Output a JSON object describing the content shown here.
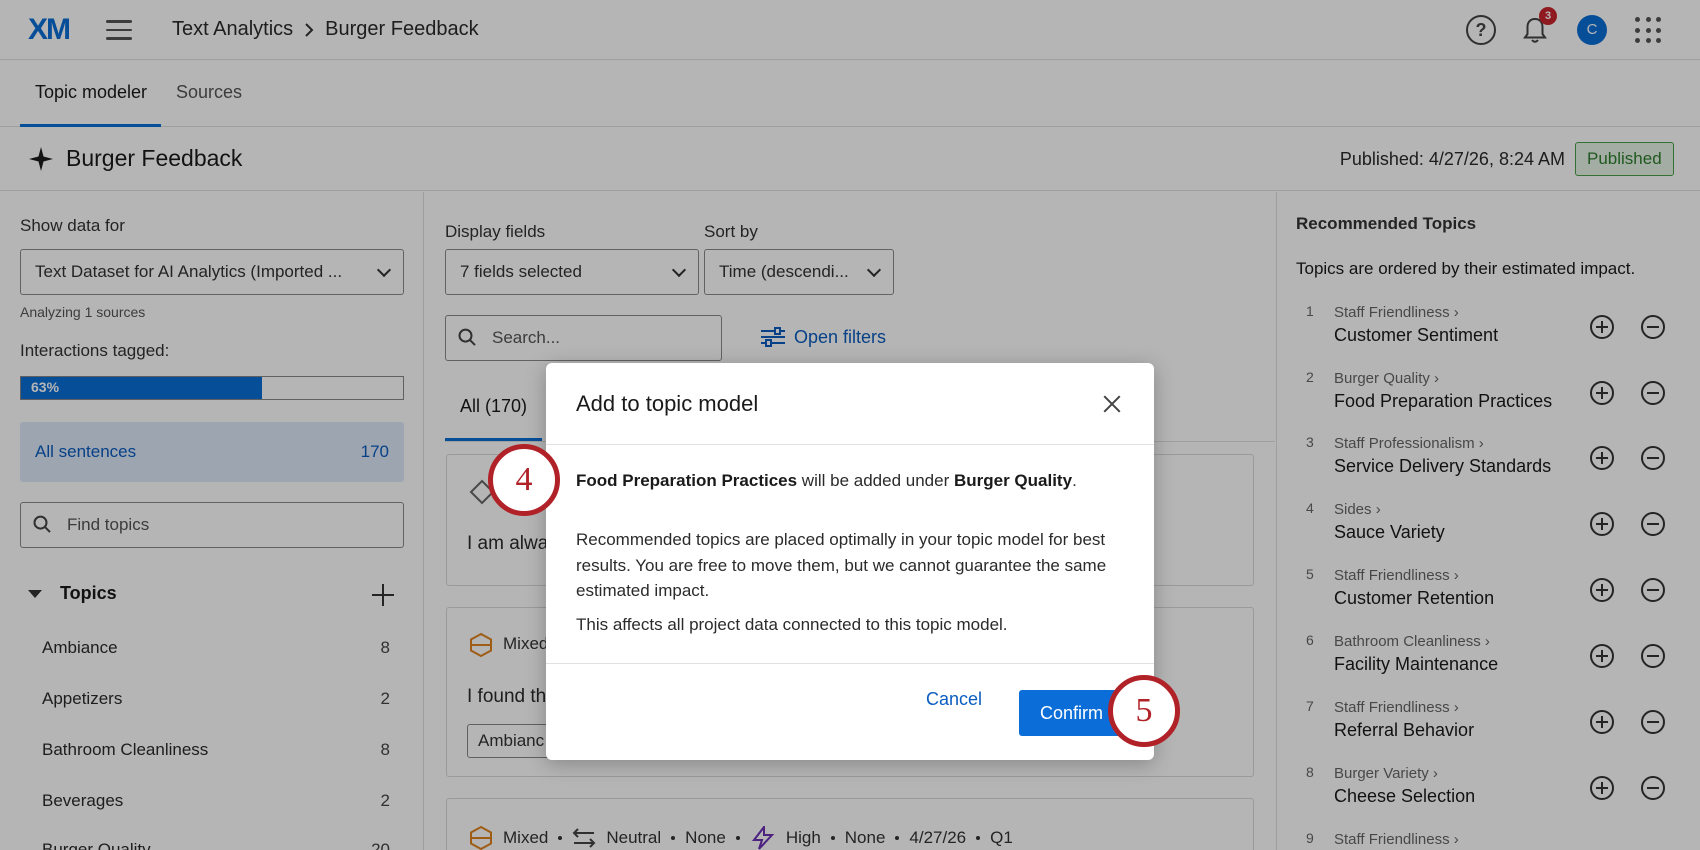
{
  "header": {
    "logo": "XM",
    "breadcrumb": [
      "Text Analytics",
      "Burger Feedback"
    ],
    "help": "?",
    "notification_count": "3",
    "avatar_initial": "C"
  },
  "tabs": [
    "Topic modeler",
    "Sources"
  ],
  "title_bar": {
    "title": "Burger Feedback",
    "published_text": "Published: 4/27/26, 8:24 AM",
    "status": "Published"
  },
  "left_panel": {
    "show_data_label": "Show data for",
    "dataset_value": "Text Dataset for AI Analytics (Imported ...",
    "analyzing": "Analyzing 1 sources",
    "tagged_label": "Interactions tagged:",
    "tagged_percent_label": "63%",
    "tagged_fraction": 0.63,
    "all_sentences_label": "All sentences",
    "all_sentences_count": "170",
    "find_placeholder": "Find topics",
    "topics_label": "Topics",
    "topics": [
      {
        "name": "Ambiance",
        "count": "8"
      },
      {
        "name": "Appetizers",
        "count": "2"
      },
      {
        "name": "Bathroom Cleanliness",
        "count": "8"
      },
      {
        "name": "Beverages",
        "count": "2"
      },
      {
        "name": "Burger Quality",
        "count": "20"
      }
    ]
  },
  "middle": {
    "display_fields_label": "Display fields",
    "display_fields_value": "7 fields selected",
    "sort_label": "Sort by",
    "sort_value": "Time (descendi...",
    "search_placeholder": "Search...",
    "open_filters": "Open filters",
    "all_tab": "All (170)",
    "card1_text": "I am alwa",
    "card2_sentiment": "Mixed",
    "card2_text": "I found th",
    "card2_chip": "Ambianc",
    "card3_meta": [
      "Mixed",
      "Neutral",
      "None",
      "High",
      "None",
      "4/27/26",
      "Q1"
    ]
  },
  "right_panel": {
    "title": "Recommended Topics",
    "subtitle": "Topics are ordered by their estimated impact.",
    "items": [
      {
        "num": "1",
        "parent": "Staff Friendliness ›",
        "name": "Customer Sentiment"
      },
      {
        "num": "2",
        "parent": "Burger Quality ›",
        "name": "Food Preparation Practices"
      },
      {
        "num": "3",
        "parent": "Staff Professionalism ›",
        "name": "Service Delivery Standards"
      },
      {
        "num": "4",
        "parent": "Sides ›",
        "name": "Sauce Variety"
      },
      {
        "num": "5",
        "parent": "Staff Friendliness ›",
        "name": "Customer Retention"
      },
      {
        "num": "6",
        "parent": "Bathroom Cleanliness ›",
        "name": "Facility Maintenance"
      },
      {
        "num": "7",
        "parent": "Staff Friendliness ›",
        "name": "Referral Behavior"
      },
      {
        "num": "8",
        "parent": "Burger Variety ›",
        "name": "Cheese Selection"
      },
      {
        "num": "9",
        "parent": "Staff Friendliness ›",
        "name": ""
      }
    ]
  },
  "modal": {
    "title": "Add to topic model",
    "topic": "Food Preparation Practices",
    "mid_text": " will be added under ",
    "parent": "Burger Quality",
    "end_text": ".",
    "paragraph1": "Recommended topics are placed optimally in your topic model for best results. You are free to move them, but we cannot guarantee the same estimated impact.",
    "paragraph2": "This affects all project data connected to this topic model.",
    "cancel": "Cancel",
    "confirm": "Confirm"
  },
  "steps": [
    "4",
    "5"
  ],
  "colors": {
    "accent": "#0b6ed8",
    "step_marker": "#b02228",
    "published": "#2e7d2e"
  }
}
